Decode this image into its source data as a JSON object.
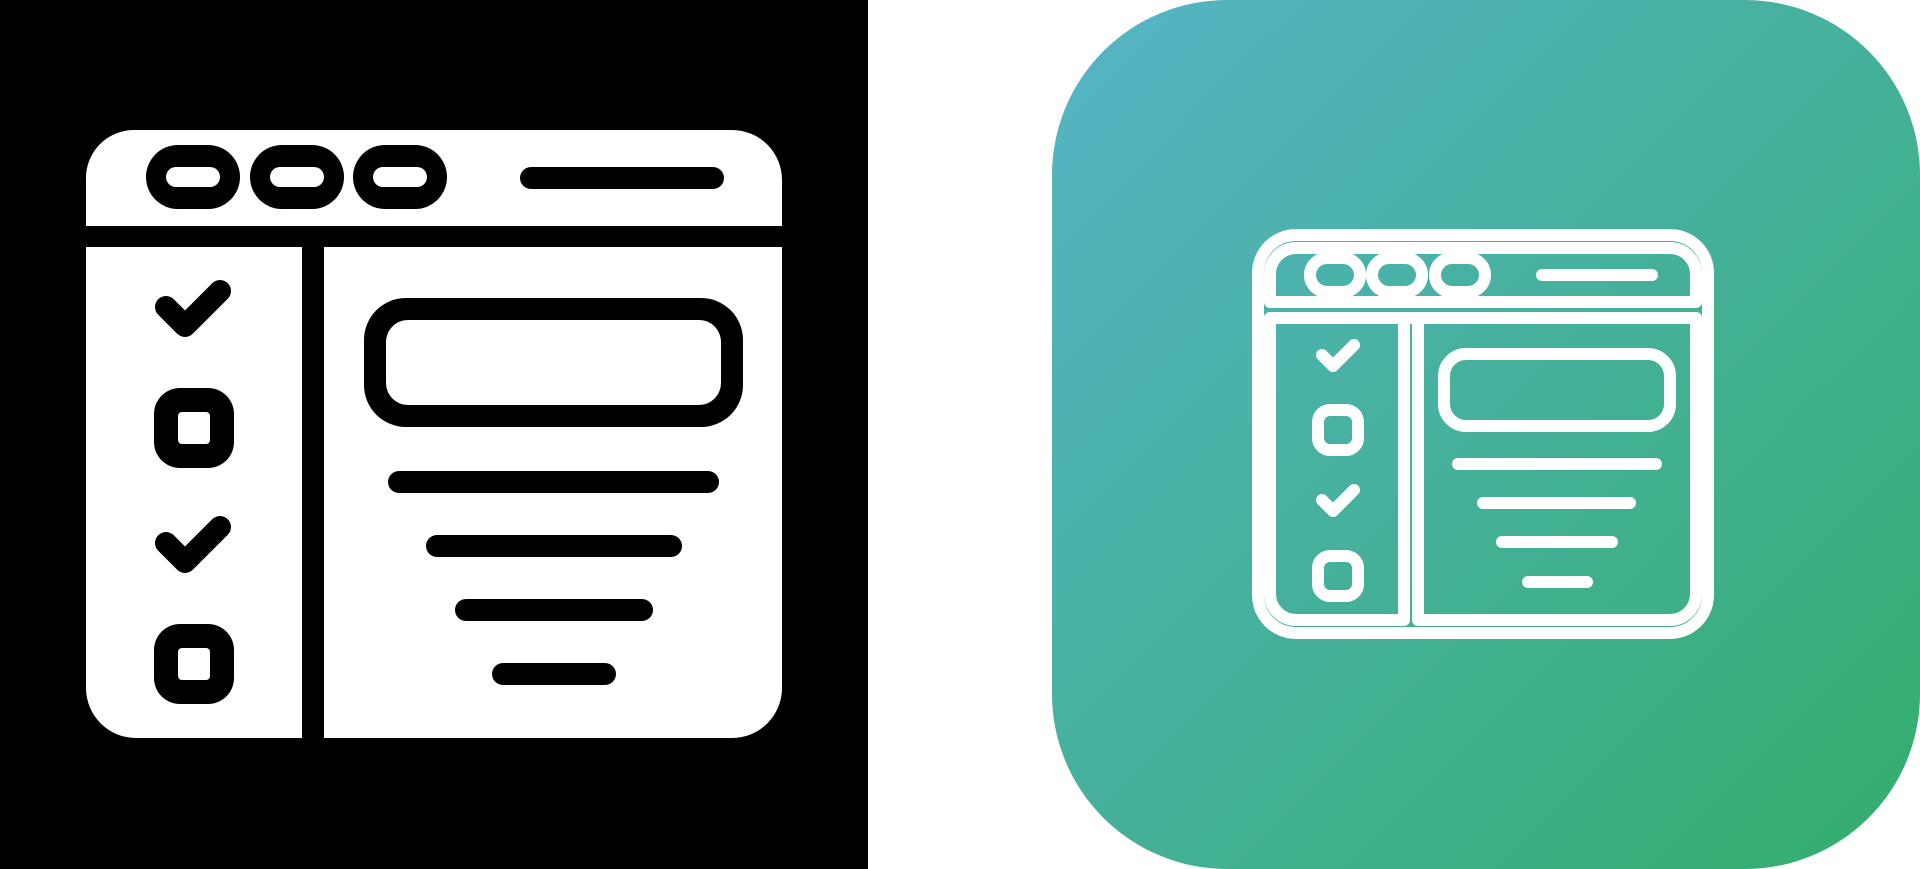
{
  "icons": [
    {
      "name": "checklist-browser-glyph-icon",
      "variant": "glyph",
      "background": "#000000",
      "foreground": "#ffffff"
    },
    {
      "name": "checklist-browser-line-icon",
      "variant": "line",
      "gradient_start": "#56b4c8",
      "gradient_end": "#34ad6c",
      "foreground": "#ffffff"
    }
  ]
}
